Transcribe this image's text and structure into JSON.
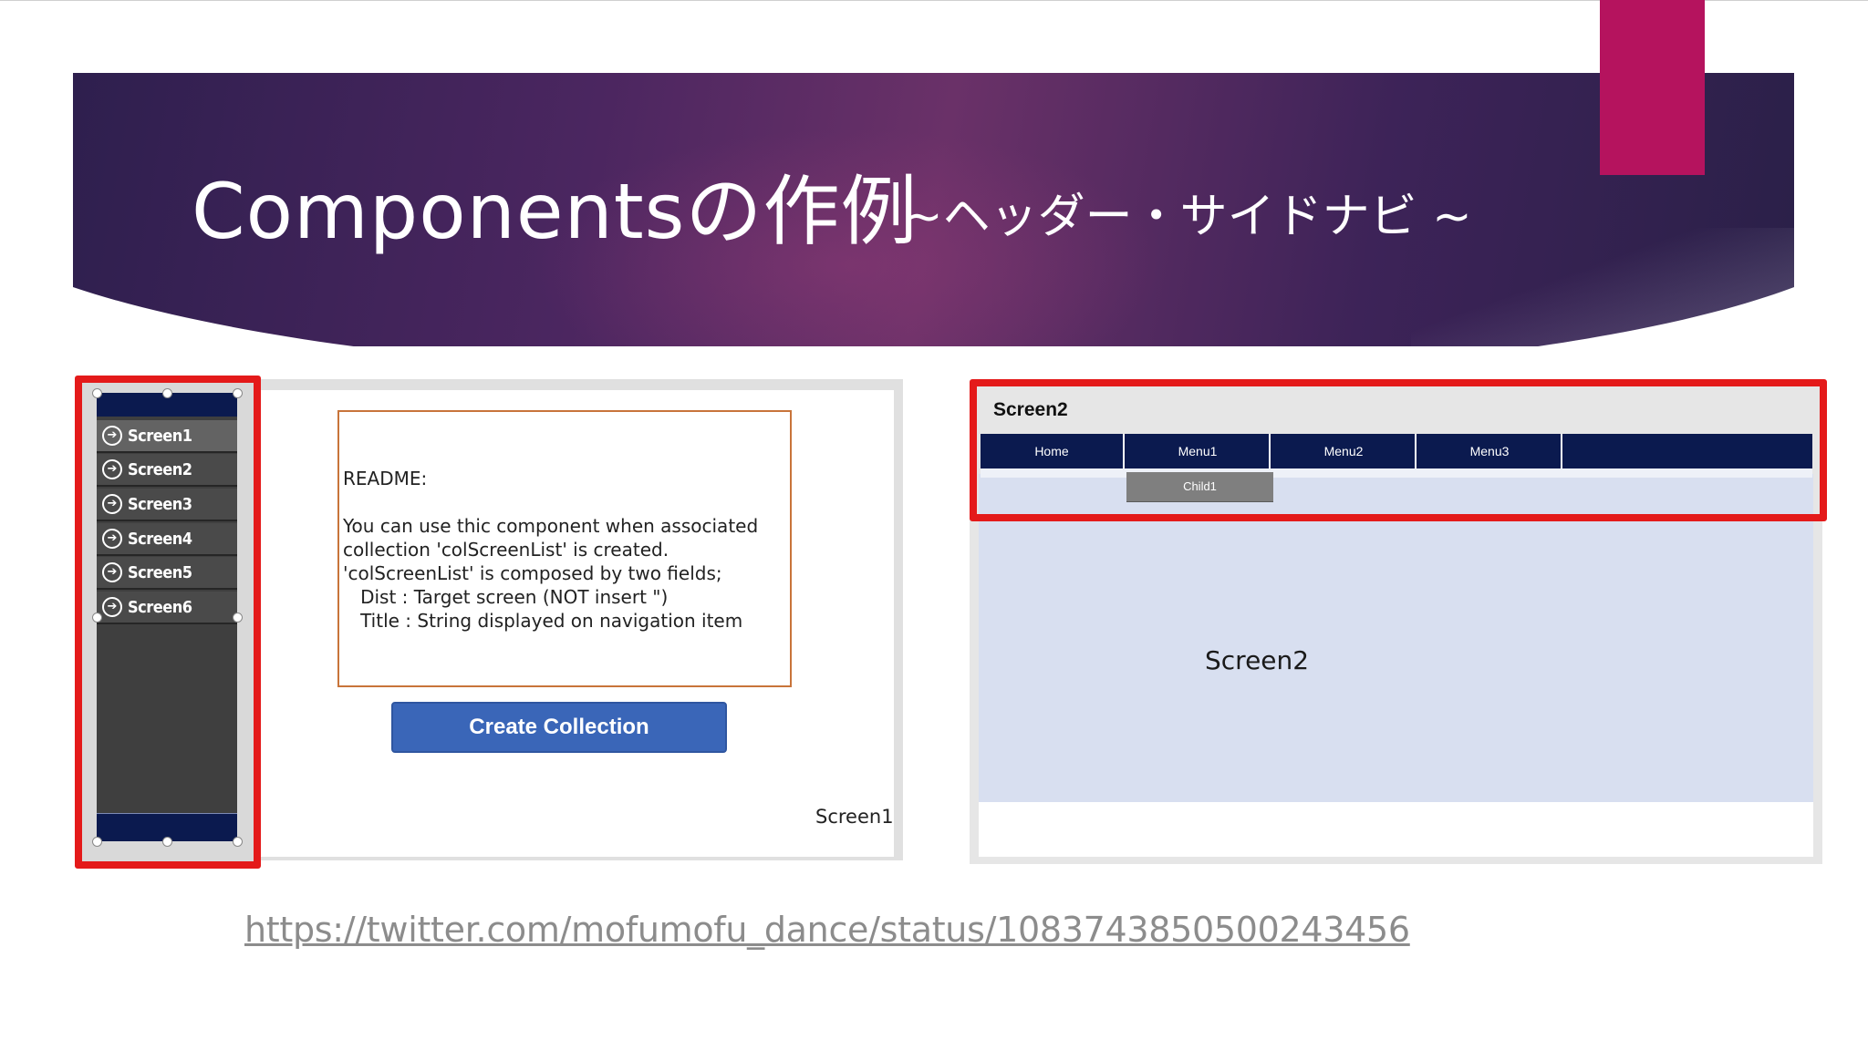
{
  "slide": {
    "title": "Componentsの作例",
    "subtitle": "~ヘッダー・サイドナビ ~",
    "link": "https://twitter.com/mofumofu_dance/status/1083743850500243456"
  },
  "sidenav": {
    "items": [
      {
        "label": "Screen1"
      },
      {
        "label": "Screen2"
      },
      {
        "label": "Screen3"
      },
      {
        "label": "Screen4"
      },
      {
        "label": "Screen5"
      },
      {
        "label": "Screen6"
      }
    ]
  },
  "left_panel": {
    "readme_text": "README:\n\nYou can use thic component when associated\ncollection 'colScreenList' is created.\n'colScreenList' is composed by two fields;\n   Dist : Target screen (NOT insert \")\n   Title : String displayed on navigation item",
    "button_label": "Create Collection",
    "screen_label": "Screen1"
  },
  "right_panel": {
    "header_title": "Screen2",
    "menu": [
      {
        "label": "Home"
      },
      {
        "label": "Menu1"
      },
      {
        "label": "Menu2"
      },
      {
        "label": "Menu3"
      }
    ],
    "child_label": "Child1",
    "screen_label": "Screen2"
  },
  "colors": {
    "accent_pink": "#b5135e",
    "highlight_red": "#e41a1a",
    "nav_navy": "#0b1a4f",
    "button_blue": "#3a66b8"
  }
}
